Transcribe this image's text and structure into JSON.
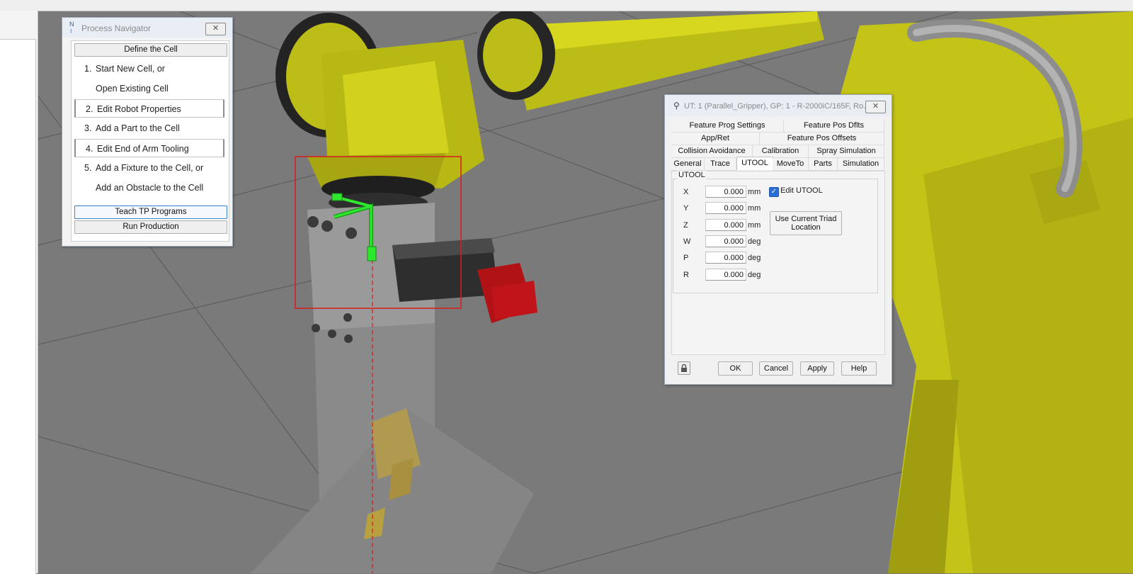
{
  "process_navigator": {
    "title": "Process Navigator",
    "icon": "process-navigator-icon",
    "define_label": "Define the Cell",
    "steps": [
      {
        "num": "1.",
        "label": "Start New Cell, or"
      },
      {
        "num": "",
        "label": "Open Existing Cell"
      },
      {
        "num": "2.",
        "label": "Edit Robot Properties"
      },
      {
        "num": "3.",
        "label": "Add a Part to the Cell"
      },
      {
        "num": "4.",
        "label": "Edit End of Arm Tooling"
      },
      {
        "num": "5.",
        "label": "Add a Fixture to the Cell, or"
      },
      {
        "num": "",
        "label": "Add an Obstacle to the Cell"
      }
    ],
    "teach_label": "Teach TP Programs",
    "run_label": "Run Production"
  },
  "utool_dialog": {
    "title": "UT: 1  (Parallel_Gripper), GP: 1 - R-2000iC/165F, Ro...",
    "icon": "tool-icon",
    "tabs_row1": [
      "Feature Prog Settings",
      "Feature Pos Dflts"
    ],
    "tabs_row2": [
      "App/Ret",
      "Feature Pos Offsets"
    ],
    "tabs_row3": [
      "Collision Avoidance",
      "Calibration",
      "Spray Simulation"
    ],
    "tabs_row4": [
      "General",
      "Trace",
      "UTOOL",
      "MoveTo",
      "Parts",
      "Simulation"
    ],
    "active_tab": "UTOOL",
    "group_label": "UTOOL",
    "fields": [
      {
        "label": "X",
        "value": "0.000",
        "unit": "mm"
      },
      {
        "label": "Y",
        "value": "0.000",
        "unit": "mm"
      },
      {
        "label": "Z",
        "value": "0.000",
        "unit": "mm"
      },
      {
        "label": "W",
        "value": "0.000",
        "unit": "deg"
      },
      {
        "label": "P",
        "value": "0.000",
        "unit": "deg"
      },
      {
        "label": "R",
        "value": "0.000",
        "unit": "deg"
      }
    ],
    "edit_utool_label": "Edit UTOOL",
    "edit_utool_checked": true,
    "triad_button_line1": "Use Current Triad",
    "triad_button_line2": "Location",
    "ok_label": "OK",
    "cancel_label": "Cancel",
    "apply_label": "Apply",
    "help_label": "Help"
  },
  "colors": {
    "robot_yellow": "#c9c91a",
    "tool_red": "#c0141a",
    "selection_box": "#d81c1c",
    "triad_green": "#2ee82e",
    "floor_gray": "#7a7a7a",
    "accent_blue": "#2a6fd6"
  }
}
